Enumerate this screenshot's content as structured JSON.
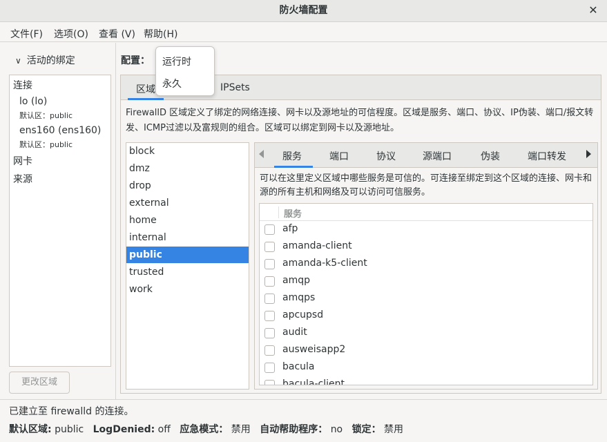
{
  "window": {
    "title": "防火墙配置"
  },
  "menubar": {
    "items": [
      {
        "label": "文件(F)"
      },
      {
        "label": "选项(O)"
      },
      {
        "label": "查看 (V)"
      },
      {
        "label": "帮助(H)"
      }
    ]
  },
  "sidebar": {
    "header": "活动的绑定",
    "connections_label": "连接",
    "connections": [
      {
        "name": "lo (lo)",
        "zone": "默认区：public"
      },
      {
        "name": "ens160 (ens160)",
        "zone": "默认区：public"
      }
    ],
    "interfaces_label": "网卡",
    "sources_label": "来源",
    "change_zone_button": "更改区域"
  },
  "config": {
    "label": "配置：",
    "options": [
      "运行时",
      "永久"
    ]
  },
  "main_tabs": [
    {
      "label": "区域"
    },
    {
      "label": "IPSets"
    }
  ],
  "zone_description": "FirewallD 区域定义了绑定的网络连接、网卡以及源地址的可信程度。区域是服务、端口、协议、IP伪装、端口/报文转发、ICMP过滤以及富规则的组合。区域可以绑定到网卡以及源地址。",
  "zones": [
    "block",
    "dmz",
    "drop",
    "external",
    "home",
    "internal",
    "public",
    "trusted",
    "work"
  ],
  "selected_zone": "public",
  "zone_tabs": [
    {
      "label": "服务"
    },
    {
      "label": "端口"
    },
    {
      "label": "协议"
    },
    {
      "label": "源端口"
    },
    {
      "label": "伪装"
    },
    {
      "label": "端口转发"
    }
  ],
  "services_description": "可以在这里定义区域中哪些服务是可信的。可连接至绑定到这个区域的连接、网卡和源的所有主机和网络及可以访问可信服务。",
  "services_header": "服务",
  "services": [
    "afp",
    "amanda-client",
    "amanda-k5-client",
    "amqp",
    "amqps",
    "apcupsd",
    "audit",
    "ausweisapp2",
    "bacula",
    "bacula-client"
  ],
  "status": {
    "connection": "已建立至 firewalld 的连接。",
    "default_zone_label": "默认区域:",
    "default_zone_value": "public",
    "log_denied_label": "LogDenied:",
    "log_denied_value": "off",
    "panic_label": "应急模式：",
    "panic_value": "禁用",
    "helpers_label": "自动帮助程序：",
    "helpers_value": "no",
    "lockdown_label": "锁定：",
    "lockdown_value": "禁用"
  },
  "colors": {
    "accent": "#3584e4",
    "window_bg": "#f6f5f4",
    "titlebar_bg": "#e8e8e7"
  }
}
